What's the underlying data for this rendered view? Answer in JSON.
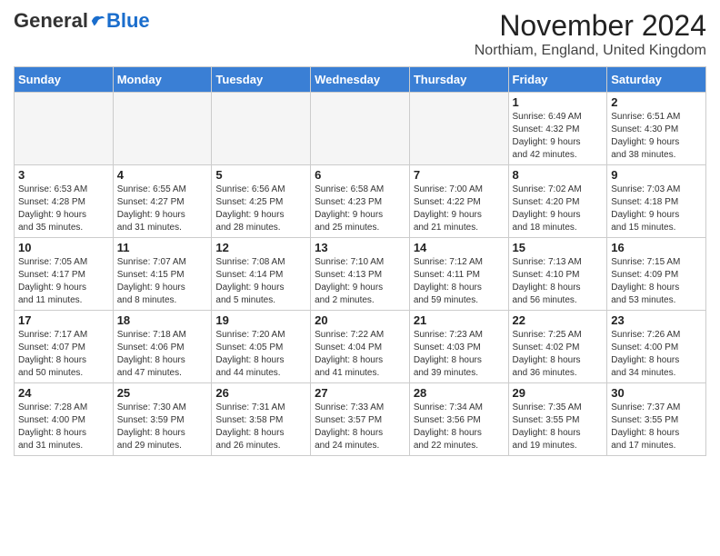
{
  "header": {
    "logo_general": "General",
    "logo_blue": "Blue",
    "month_title": "November 2024",
    "location": "Northiam, England, United Kingdom"
  },
  "days_of_week": [
    "Sunday",
    "Monday",
    "Tuesday",
    "Wednesday",
    "Thursday",
    "Friday",
    "Saturday"
  ],
  "weeks": [
    [
      {
        "day": "",
        "detail": ""
      },
      {
        "day": "",
        "detail": ""
      },
      {
        "day": "",
        "detail": ""
      },
      {
        "day": "",
        "detail": ""
      },
      {
        "day": "",
        "detail": ""
      },
      {
        "day": "1",
        "detail": "Sunrise: 6:49 AM\nSunset: 4:32 PM\nDaylight: 9 hours\nand 42 minutes."
      },
      {
        "day": "2",
        "detail": "Sunrise: 6:51 AM\nSunset: 4:30 PM\nDaylight: 9 hours\nand 38 minutes."
      }
    ],
    [
      {
        "day": "3",
        "detail": "Sunrise: 6:53 AM\nSunset: 4:28 PM\nDaylight: 9 hours\nand 35 minutes."
      },
      {
        "day": "4",
        "detail": "Sunrise: 6:55 AM\nSunset: 4:27 PM\nDaylight: 9 hours\nand 31 minutes."
      },
      {
        "day": "5",
        "detail": "Sunrise: 6:56 AM\nSunset: 4:25 PM\nDaylight: 9 hours\nand 28 minutes."
      },
      {
        "day": "6",
        "detail": "Sunrise: 6:58 AM\nSunset: 4:23 PM\nDaylight: 9 hours\nand 25 minutes."
      },
      {
        "day": "7",
        "detail": "Sunrise: 7:00 AM\nSunset: 4:22 PM\nDaylight: 9 hours\nand 21 minutes."
      },
      {
        "day": "8",
        "detail": "Sunrise: 7:02 AM\nSunset: 4:20 PM\nDaylight: 9 hours\nand 18 minutes."
      },
      {
        "day": "9",
        "detail": "Sunrise: 7:03 AM\nSunset: 4:18 PM\nDaylight: 9 hours\nand 15 minutes."
      }
    ],
    [
      {
        "day": "10",
        "detail": "Sunrise: 7:05 AM\nSunset: 4:17 PM\nDaylight: 9 hours\nand 11 minutes."
      },
      {
        "day": "11",
        "detail": "Sunrise: 7:07 AM\nSunset: 4:15 PM\nDaylight: 9 hours\nand 8 minutes."
      },
      {
        "day": "12",
        "detail": "Sunrise: 7:08 AM\nSunset: 4:14 PM\nDaylight: 9 hours\nand 5 minutes."
      },
      {
        "day": "13",
        "detail": "Sunrise: 7:10 AM\nSunset: 4:13 PM\nDaylight: 9 hours\nand 2 minutes."
      },
      {
        "day": "14",
        "detail": "Sunrise: 7:12 AM\nSunset: 4:11 PM\nDaylight: 8 hours\nand 59 minutes."
      },
      {
        "day": "15",
        "detail": "Sunrise: 7:13 AM\nSunset: 4:10 PM\nDaylight: 8 hours\nand 56 minutes."
      },
      {
        "day": "16",
        "detail": "Sunrise: 7:15 AM\nSunset: 4:09 PM\nDaylight: 8 hours\nand 53 minutes."
      }
    ],
    [
      {
        "day": "17",
        "detail": "Sunrise: 7:17 AM\nSunset: 4:07 PM\nDaylight: 8 hours\nand 50 minutes."
      },
      {
        "day": "18",
        "detail": "Sunrise: 7:18 AM\nSunset: 4:06 PM\nDaylight: 8 hours\nand 47 minutes."
      },
      {
        "day": "19",
        "detail": "Sunrise: 7:20 AM\nSunset: 4:05 PM\nDaylight: 8 hours\nand 44 minutes."
      },
      {
        "day": "20",
        "detail": "Sunrise: 7:22 AM\nSunset: 4:04 PM\nDaylight: 8 hours\nand 41 minutes."
      },
      {
        "day": "21",
        "detail": "Sunrise: 7:23 AM\nSunset: 4:03 PM\nDaylight: 8 hours\nand 39 minutes."
      },
      {
        "day": "22",
        "detail": "Sunrise: 7:25 AM\nSunset: 4:02 PM\nDaylight: 8 hours\nand 36 minutes."
      },
      {
        "day": "23",
        "detail": "Sunrise: 7:26 AM\nSunset: 4:00 PM\nDaylight: 8 hours\nand 34 minutes."
      }
    ],
    [
      {
        "day": "24",
        "detail": "Sunrise: 7:28 AM\nSunset: 4:00 PM\nDaylight: 8 hours\nand 31 minutes."
      },
      {
        "day": "25",
        "detail": "Sunrise: 7:30 AM\nSunset: 3:59 PM\nDaylight: 8 hours\nand 29 minutes."
      },
      {
        "day": "26",
        "detail": "Sunrise: 7:31 AM\nSunset: 3:58 PM\nDaylight: 8 hours\nand 26 minutes."
      },
      {
        "day": "27",
        "detail": "Sunrise: 7:33 AM\nSunset: 3:57 PM\nDaylight: 8 hours\nand 24 minutes."
      },
      {
        "day": "28",
        "detail": "Sunrise: 7:34 AM\nSunset: 3:56 PM\nDaylight: 8 hours\nand 22 minutes."
      },
      {
        "day": "29",
        "detail": "Sunrise: 7:35 AM\nSunset: 3:55 PM\nDaylight: 8 hours\nand 19 minutes."
      },
      {
        "day": "30",
        "detail": "Sunrise: 7:37 AM\nSunset: 3:55 PM\nDaylight: 8 hours\nand 17 minutes."
      }
    ]
  ]
}
